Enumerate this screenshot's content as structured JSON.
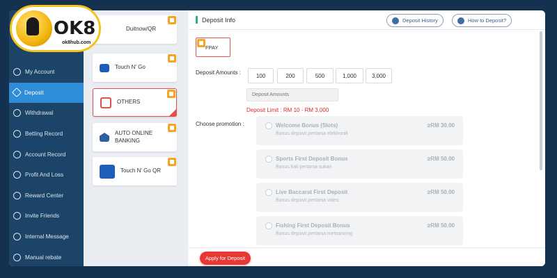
{
  "logo": {
    "text": "OK8",
    "sub": "ok8hub.com"
  },
  "nav": [
    {
      "label": "My Account",
      "icon": "account-icon"
    },
    {
      "label": "Deposit",
      "icon": "deposit-icon",
      "active": true
    },
    {
      "label": "Withdrawal",
      "icon": "withdrawal-icon"
    },
    {
      "label": "Betting Record",
      "icon": "betting-record-icon"
    },
    {
      "label": "Account Record",
      "icon": "account-record-icon"
    },
    {
      "label": "Profit And Loss",
      "icon": "profit-loss-icon"
    },
    {
      "label": "Reward Center",
      "icon": "reward-icon"
    },
    {
      "label": "Invite Friends",
      "icon": "invite-icon"
    },
    {
      "label": "Internal Message",
      "icon": "message-icon"
    },
    {
      "label": "Manual rebate",
      "icon": "rebate-icon"
    }
  ],
  "methods": [
    {
      "label": "Duitnow/QR"
    },
    {
      "label": "Touch N' Go"
    },
    {
      "label": "OTHERS",
      "selected": true
    },
    {
      "label": "AUTO ONLINE\nBANKING"
    },
    {
      "label": "Touch N' Go QR"
    }
  ],
  "main": {
    "title": "Deposit Info",
    "history_btn": "Deposit History",
    "howto_btn": "How to Deposit?",
    "channel": "FPAY",
    "amounts_label": "Deposit Amounts :",
    "amounts": [
      "100",
      "200",
      "500",
      "1,000",
      "3,000"
    ],
    "amount_placeholder": "Deposit Amounts",
    "limit_text": "Deposit Limit : RM 10 - RM 3,000",
    "promotion_label": "Choose promotion :",
    "promotions": [
      {
        "name": "Welcome Bonus (Slots)",
        "desc": "Bonus deposit pertama elektronik",
        "amount": "≥RM 30.00"
      },
      {
        "name": "Sports First Deposit Bonus",
        "desc": "Bonus kali pertama sukan",
        "amount": "≥RM 50.00"
      },
      {
        "name": "Live Baccarat First Deposit",
        "desc": "Bonus deposit pertama video",
        "amount": "≥RM 50.00"
      },
      {
        "name": "Fishing First Deposit Bonus",
        "desc": "Bonus deposit pertama memancing",
        "amount": "≥RM 50.00"
      }
    ],
    "apply_btn": "Apply for Deposit"
  },
  "colors": {
    "sidebar": "#1b4468",
    "active": "#2f8dd8",
    "accent_red": "#e53935",
    "badge": "#f5a524",
    "title_bar": "#2bb673"
  }
}
